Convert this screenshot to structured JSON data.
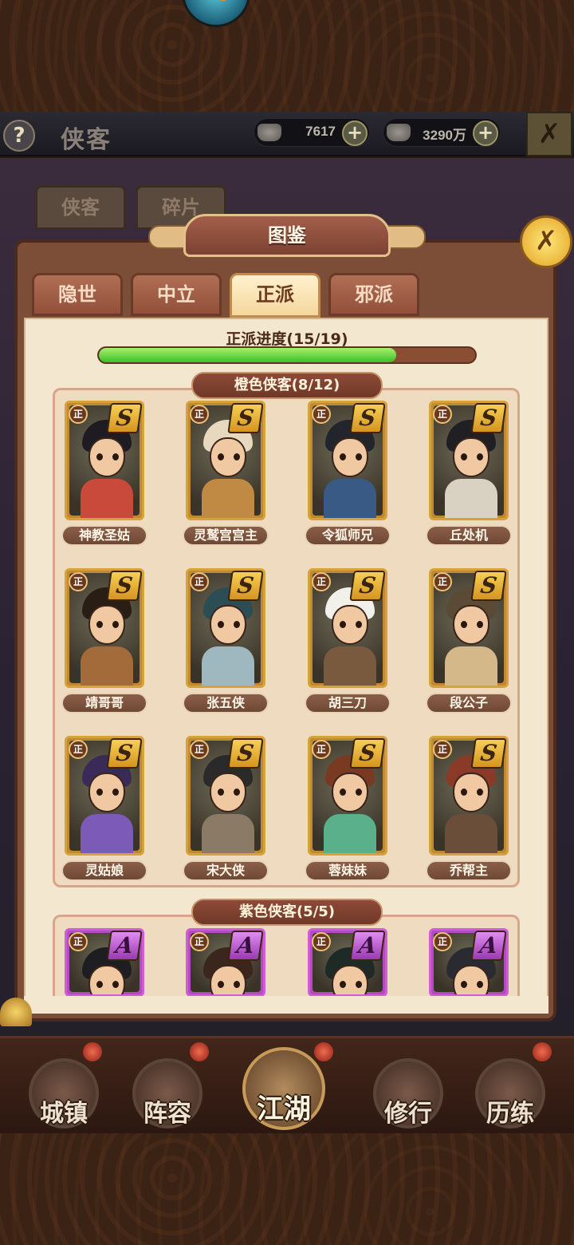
{
  "header": {
    "help_icon_text": "?",
    "title": "侠客",
    "gold": "7617",
    "silver": "3290万",
    "plus": "+"
  },
  "bg_tabs": [
    "侠客",
    "碎片"
  ],
  "panel": {
    "title": "图鉴",
    "tabs": [
      "隐世",
      "中立",
      "正派",
      "邪派"
    ],
    "active_tab": "正派",
    "progress_label": "正派进度(15/19)",
    "progress_current": 15,
    "progress_total": 19
  },
  "orange_section": {
    "heading": "橙色侠客(8/12)",
    "grade": "S",
    "faction_badge": "正",
    "heroes": [
      {
        "name": "神教圣姑",
        "hair": "#1e1b22",
        "body": "#c94a3a"
      },
      {
        "name": "灵鹫宫宫主",
        "hair": "#e7d9c0",
        "body": "#c08a45"
      },
      {
        "name": "令狐师兄",
        "hair": "#23252c",
        "body": "#3a5a86"
      },
      {
        "name": "丘处机",
        "hair": "#1f1f24",
        "body": "#d9d2c2"
      },
      {
        "name": "靖哥哥",
        "hair": "#2a1d16",
        "body": "#a36a3a"
      },
      {
        "name": "张五侠",
        "hair": "#2d4d55",
        "body": "#9fb8c0"
      },
      {
        "name": "胡三刀",
        "hair": "#f2f0ea",
        "body": "#7a5a3e"
      },
      {
        "name": "段公子",
        "hair": "#5a4a36",
        "body": "#d4b88a"
      },
      {
        "name": "灵姑娘",
        "hair": "#3a2a58",
        "body": "#7b5ab8"
      },
      {
        "name": "宋大侠",
        "hair": "#2a2a2a",
        "body": "#8a7a66"
      },
      {
        "name": "蓉妹妹",
        "hair": "#7a3a22",
        "body": "#5ab08a"
      },
      {
        "name": "乔帮主",
        "hair": "#8a3a26",
        "body": "#6a4e3a"
      }
    ]
  },
  "purple_section": {
    "heading": "紫色侠客(5/5)",
    "grade": "A",
    "faction_badge": "正",
    "heroes": [
      {
        "hair": "#1e1e22",
        "body": "#5a4a3a"
      },
      {
        "hair": "#3a261c",
        "body": "#8a7a6a"
      },
      {
        "hair": "#1e2a26",
        "body": "#4a6a5a"
      },
      {
        "hair": "#2a2a32",
        "body": "#6a6a7a"
      }
    ]
  },
  "close_icon_text": "✗",
  "nav": {
    "items": [
      "城镇",
      "阵容",
      "江湖",
      "修行",
      "历练"
    ],
    "active": "江湖"
  },
  "colors": {
    "progress_fill": "#3cbf28",
    "orange_card": "#d8a23a",
    "purple_card": "#cf5cd8"
  }
}
